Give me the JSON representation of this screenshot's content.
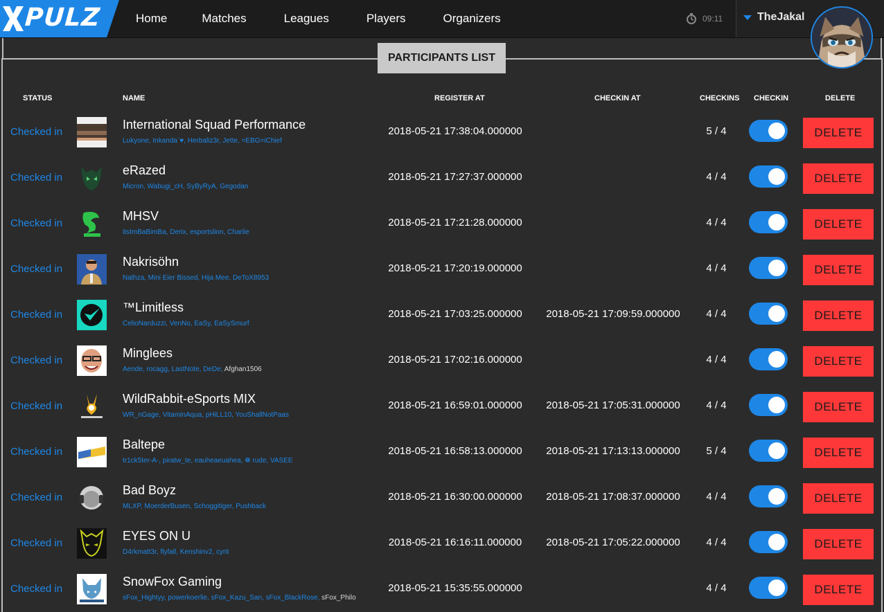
{
  "brand": {
    "name": "PULZ",
    "accent": "#1e87e6"
  },
  "nav": [
    {
      "label": "Home"
    },
    {
      "label": "Matches"
    },
    {
      "label": "Leagues"
    },
    {
      "label": "Players"
    },
    {
      "label": "Organizers"
    }
  ],
  "header": {
    "time": "09:11",
    "username": "TheJakal",
    "clock_icon": "clock-icon"
  },
  "panel": {
    "title": "PARTICIPANTS LIST"
  },
  "columns": {
    "status": "STATUS",
    "name": "NAME",
    "register_at": "REGISTER AT",
    "checkin_at": "CHECKIN AT",
    "checkins": "CHECKINS",
    "checkin": "CHECKIN",
    "delete": "DELETE"
  },
  "colors": {
    "status_blue": "#1e87e6",
    "delete_red": "#fe3838",
    "panel_title_bg": "#c9c9c9"
  },
  "rows": [
    {
      "status": "Checked in",
      "name": "International Squad Performance",
      "members": "Lukyone, Inkanda`♥, Herbaliz3r, Jette, =EBG=iChief",
      "members_extra": "",
      "register_at": "2018-05-21 17:38:04.000000",
      "checkin_at": "",
      "checkins": "5 / 4",
      "checkin_on": true,
      "delete_label": "DELETE"
    },
    {
      "status": "Checked in",
      "name": "eRazed",
      "members": "Micron, Wabugi_cH, SyByRyA, Gegodan",
      "members_extra": "",
      "register_at": "2018-05-21 17:27:37.000000",
      "checkin_at": "",
      "checkins": "4 / 4",
      "checkin_on": true,
      "delete_label": "DELETE"
    },
    {
      "status": "Checked in",
      "name": "MHSV",
      "members": "itsImBaBimBa, Derix, esportslion, Charlie",
      "members_extra": "",
      "register_at": "2018-05-21 17:21:28.000000",
      "checkin_at": "",
      "checkins": "4 / 4",
      "checkin_on": true,
      "delete_label": "DELETE"
    },
    {
      "status": "Checked in",
      "name": "Nakrisöhn",
      "members": "Nalhza, Mini Eier Bissed, Hija Mee, DeToX8953",
      "members_extra": "",
      "register_at": "2018-05-21 17:20:19.000000",
      "checkin_at": "",
      "checkins": "4 / 4",
      "checkin_on": true,
      "delete_label": "DELETE"
    },
    {
      "status": "Checked in",
      "name": "™Limitless",
      "members": "CelioNarduzzi, VenNo, EaSy, EaSySmurf",
      "members_extra": "",
      "register_at": "2018-05-21 17:03:25.000000",
      "checkin_at": "2018-05-21 17:09:59.000000",
      "checkins": "4 / 4",
      "checkin_on": true,
      "delete_label": "DELETE"
    },
    {
      "status": "Checked in",
      "name": "Minglees",
      "members": "Aende, rocagg, LastNote, DeDe,",
      "members_extra": "Afghan1506",
      "register_at": "2018-05-21 17:02:16.000000",
      "checkin_at": "",
      "checkins": "4 / 4",
      "checkin_on": true,
      "delete_label": "DELETE"
    },
    {
      "status": "Checked in",
      "name": "WildRabbit-eSports MIX",
      "members": "WR_nGage, VitaminAqua, pHiLL10, YouShallNotPaas",
      "members_extra": "",
      "register_at": "2018-05-21 16:59:01.000000",
      "checkin_at": "2018-05-21 17:05:31.000000",
      "checkins": "4 / 4",
      "checkin_on": true,
      "delete_label": "DELETE"
    },
    {
      "status": "Checked in",
      "name": "Baltepe",
      "members": "tr1ck5ter-A-, piratw_te, eauheaeuahea, ❁ rude, VASEE",
      "members_extra": "",
      "register_at": "2018-05-21 16:58:13.000000",
      "checkin_at": "2018-05-21 17:13:13.000000",
      "checkins": "5 / 4",
      "checkin_on": true,
      "delete_label": "DELETE"
    },
    {
      "status": "Checked in",
      "name": "Bad Boyz",
      "members": "MLXP, MoerderBusen, Schoggitiger, Pushback",
      "members_extra": "",
      "register_at": "2018-05-21 16:30:00.000000",
      "checkin_at": "2018-05-21 17:08:37.000000",
      "checkins": "4 / 4",
      "checkin_on": true,
      "delete_label": "DELETE"
    },
    {
      "status": "Checked in",
      "name": "EYES ON U",
      "members": "D4rkmatt3r, flyfall, Kenshinv2, cyrit",
      "members_extra": "",
      "register_at": "2018-05-21 16:16:11.000000",
      "checkin_at": "2018-05-21 17:05:22.000000",
      "checkins": "4 / 4",
      "checkin_on": true,
      "delete_label": "DELETE"
    },
    {
      "status": "Checked in",
      "name": "SnowFox Gaming",
      "members": "sFox_Hightyy, powerkoerlie, sFox_Kazu_San, sFox_BlackRose,",
      "members_extra": "sFox_Philo",
      "register_at": "2018-05-21 15:35:55.000000",
      "checkin_at": "",
      "checkins": "4 / 4",
      "checkin_on": true,
      "delete_label": "DELETE"
    }
  ]
}
